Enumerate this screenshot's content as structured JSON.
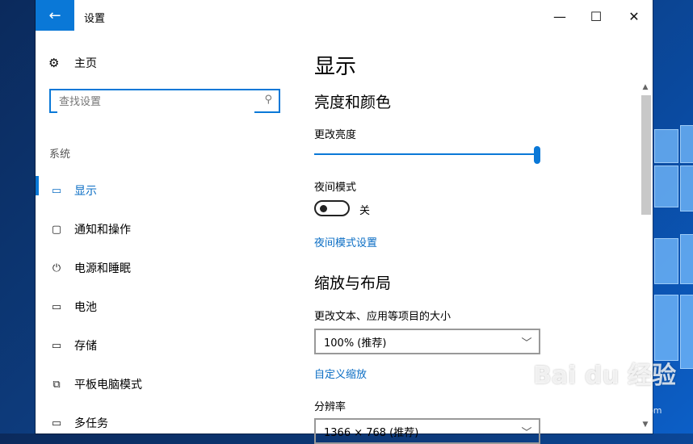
{
  "window": {
    "title": "设置",
    "back_icon": "←",
    "min_icon": "—",
    "max_icon": "☐",
    "close_icon": "✕"
  },
  "sidebar": {
    "home": {
      "icon": "⚙",
      "label": "主页"
    },
    "search": {
      "placeholder": "查找设置",
      "icon": "⚲"
    },
    "section": "系统",
    "items": [
      {
        "icon": "▭",
        "label": "显示",
        "active": true
      },
      {
        "icon": "▢",
        "label": "通知和操作"
      },
      {
        "icon": "⏻",
        "label": "电源和睡眠"
      },
      {
        "icon": "▭",
        "label": "电池"
      },
      {
        "icon": "▭",
        "label": "存储"
      },
      {
        "icon": "⧉",
        "label": "平板电脑模式"
      },
      {
        "icon": "▭",
        "label": "多任务"
      }
    ]
  },
  "main": {
    "title": "显示",
    "brightness_section": "亮度和颜色",
    "brightness_label": "更改亮度",
    "brightness_value": 1.0,
    "night_mode_label": "夜间模式",
    "night_mode_state": "关",
    "night_mode_link": "夜间模式设置",
    "scale_section": "缩放与布局",
    "scale_label": "更改文本、应用等项目的大小",
    "scale_value": "100% (推荐)",
    "custom_scale_link": "自定义缩放",
    "resolution_label": "分辨率",
    "resolution_value": "1366 × 768 (推荐)",
    "chevron_icon": "﹀"
  },
  "watermark": {
    "text": "Bai du 经验",
    "sub": "jingyan.baidu.com"
  },
  "colors": {
    "accent": "#0a78d7",
    "link": "#0a6dc4"
  }
}
